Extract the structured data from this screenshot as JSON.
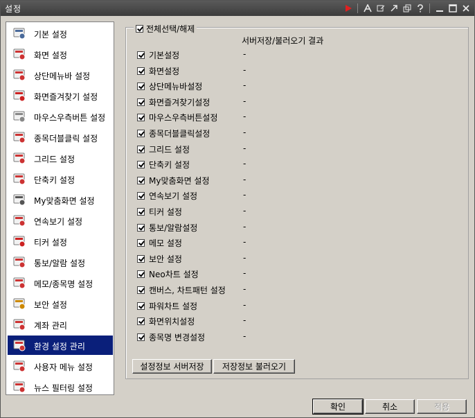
{
  "window": {
    "title": "설정"
  },
  "titlebar_icons": [
    "play-icon",
    "font-icon",
    "edit-icon",
    "pin-icon",
    "restore-icon",
    "help-icon",
    "minimize-icon",
    "maximize-icon",
    "close-icon"
  ],
  "sidebar": {
    "items": [
      {
        "label": "기본 설정",
        "icon": "monitor-gear-icon",
        "color": "#4a6a9a"
      },
      {
        "label": "화면 설정",
        "icon": "screen-icon",
        "color": "#cc3333"
      },
      {
        "label": "상단메뉴바 설정",
        "icon": "menubar-icon",
        "color": "#cc3333"
      },
      {
        "label": "화면즐겨찾기 설정",
        "icon": "star-icon",
        "color": "#cc2222"
      },
      {
        "label": "마우스우측버튼 설정",
        "icon": "mouse-icon",
        "color": "#888888"
      },
      {
        "label": "종목더블클릭 설정",
        "icon": "cursor-click-icon",
        "color": "#cc3333"
      },
      {
        "label": "그리드 설정",
        "icon": "grid-icon",
        "color": "#cc3333"
      },
      {
        "label": "단축키 설정",
        "icon": "shortcut-key-icon",
        "color": "#cc3333"
      },
      {
        "label": "My맞춤화면 설정",
        "icon": "user-screen-icon",
        "color": "#555555"
      },
      {
        "label": "연속보기 설정",
        "icon": "magnifier-icon",
        "color": "#cc3333"
      },
      {
        "label": "티커 설정",
        "icon": "ticker-icon",
        "color": "#cc2222"
      },
      {
        "label": "통보/알람 설정",
        "icon": "alarm-icon",
        "color": "#cc3333"
      },
      {
        "label": "메모/종목명 설정",
        "icon": "memo-icon",
        "color": "#cc3333"
      },
      {
        "label": "보안 설정",
        "icon": "shield-icon",
        "color": "#cc8800"
      },
      {
        "label": "계좌 관리",
        "icon": "account-icon",
        "color": "#cc3333"
      },
      {
        "label": "환경 설정 관리",
        "icon": "settings-gear-icon",
        "color": "#cc3333"
      },
      {
        "label": "사용자 메뉴 설정",
        "icon": "user-menu-icon",
        "color": "#cc3333"
      },
      {
        "label": "뉴스 필터링 설정",
        "icon": "news-filter-icon",
        "color": "#cc3333"
      }
    ],
    "selected_index": 15
  },
  "panel": {
    "select_all_label": "전체선택/해제",
    "select_all_checked": true,
    "result_header": "서버저장/불러오기 결과",
    "options": [
      {
        "label": "기본설정",
        "checked": true,
        "result": "-"
      },
      {
        "label": "화면설정",
        "checked": true,
        "result": "-"
      },
      {
        "label": "상단메뉴바설정",
        "checked": true,
        "result": "-"
      },
      {
        "label": "화면즐겨찾기설정",
        "checked": true,
        "result": "-"
      },
      {
        "label": "마우스우측버튼설정",
        "checked": true,
        "result": "-"
      },
      {
        "label": "종목더블클릭설정",
        "checked": true,
        "result": "-"
      },
      {
        "label": "그리드 설정",
        "checked": true,
        "result": "-"
      },
      {
        "label": "단축키 설정",
        "checked": true,
        "result": "-"
      },
      {
        "label": "My맞춤화면 설정",
        "checked": true,
        "result": "-"
      },
      {
        "label": "연속보기 설정",
        "checked": true,
        "result": "-"
      },
      {
        "label": "티커 설정",
        "checked": true,
        "result": "-"
      },
      {
        "label": "통보/알람설정",
        "checked": true,
        "result": "-"
      },
      {
        "label": "메모 설정",
        "checked": true,
        "result": "-"
      },
      {
        "label": "보안 설정",
        "checked": true,
        "result": "-"
      },
      {
        "label": "Neo차트 설정",
        "checked": true,
        "result": "-"
      },
      {
        "label": "캔버스, 차트패턴 설정",
        "checked": true,
        "result": "-"
      },
      {
        "label": "파워차트 설정",
        "checked": true,
        "result": "-"
      },
      {
        "label": "화면위치설정",
        "checked": true,
        "result": "-"
      },
      {
        "label": "종목명 변경설정",
        "checked": true,
        "result": "-"
      }
    ],
    "save_server_label": "설정정보 서버저장",
    "load_saved_label": "저장정보 불러오기"
  },
  "footer": {
    "ok_label": "확인",
    "cancel_label": "취소",
    "apply_label": "적용"
  },
  "colors": {
    "selected_bg": "#0a1f7a",
    "titlebar": "#474747",
    "dialog_bg": "#d4d0c8"
  }
}
